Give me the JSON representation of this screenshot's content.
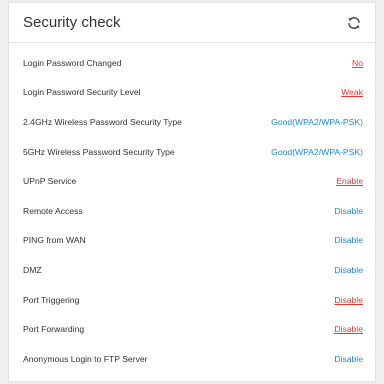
{
  "panel": {
    "title": "Security check",
    "refresh_icon": "refresh-icon"
  },
  "colors": {
    "warning": "#e53935",
    "ok": "#1e88e5"
  },
  "items": [
    {
      "label": "Login Password Changed",
      "value": "No",
      "status": "bad"
    },
    {
      "label": "Login Password Security Level",
      "value": "Weak",
      "status": "bad"
    },
    {
      "label": "2.4GHz Wireless Password Security Type",
      "value": "Good(WPA2/WPA-PSK)",
      "status": "good"
    },
    {
      "label": "5GHz Wireless Password Security Type",
      "value": "Good(WPA2/WPA-PSK)",
      "status": "good"
    },
    {
      "label": "UPnP Service",
      "value": "Enable",
      "status": "bad"
    },
    {
      "label": "Remote Access",
      "value": "Disable",
      "status": "good"
    },
    {
      "label": "PING from WAN",
      "value": "Disable",
      "status": "good"
    },
    {
      "label": "DMZ",
      "value": "Disable",
      "status": "good"
    },
    {
      "label": "Port Triggering",
      "value": "Disable",
      "status": "bad"
    },
    {
      "label": "Port Forwarding",
      "value": "Disable",
      "status": "bad"
    },
    {
      "label": "Anonymous Login to FTP Server",
      "value": "Disable",
      "status": "good"
    }
  ]
}
